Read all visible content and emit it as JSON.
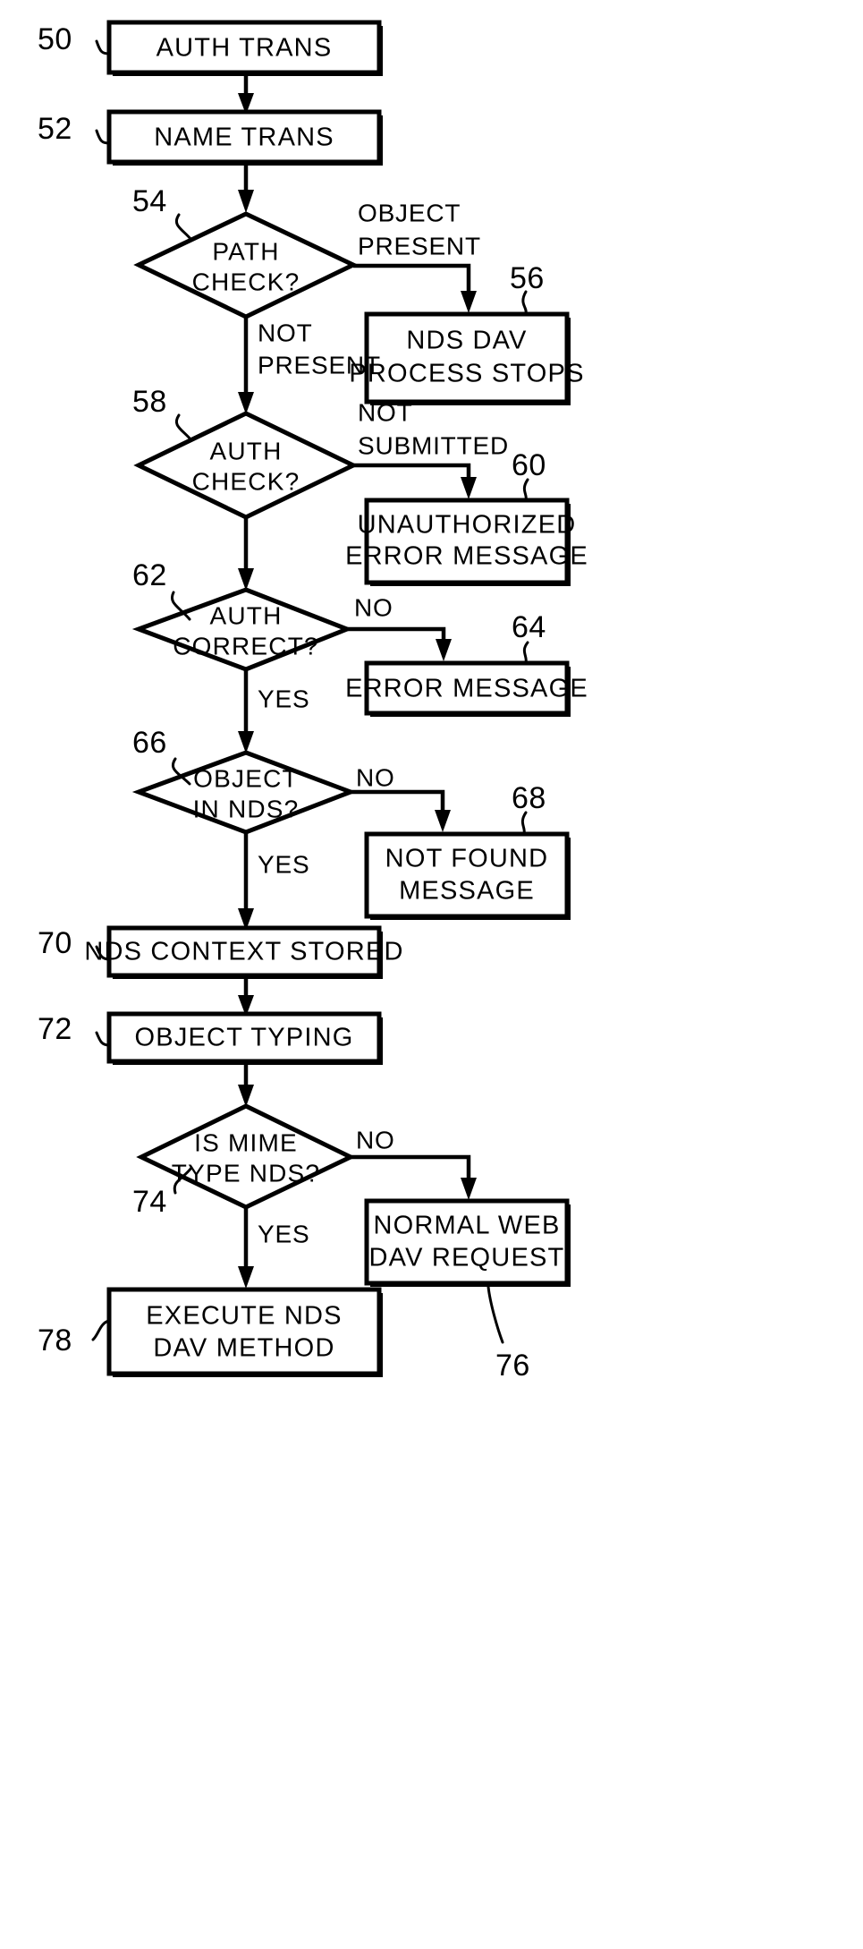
{
  "figure": {
    "title": "NDS DAV process flowchart",
    "line_color": "#000000",
    "fill_color": "#ffffff"
  },
  "nodes": [
    {
      "id": "n50",
      "ref": "50",
      "type": "process",
      "lines": [
        "AUTH TRANS"
      ]
    },
    {
      "id": "n52",
      "ref": "52",
      "type": "process",
      "lines": [
        "NAME TRANS"
      ]
    },
    {
      "id": "n54",
      "ref": "54",
      "type": "decision",
      "lines": [
        "PATH",
        "CHECK?"
      ]
    },
    {
      "id": "n56",
      "ref": "56",
      "type": "process",
      "lines": [
        "NDS DAV",
        "PROCESS STOPS"
      ]
    },
    {
      "id": "n58",
      "ref": "58",
      "type": "decision",
      "lines": [
        "AUTH",
        "CHECK?"
      ]
    },
    {
      "id": "n60",
      "ref": "60",
      "type": "process",
      "lines": [
        "UNAUTHORIZED",
        "ERROR MESSAGE"
      ]
    },
    {
      "id": "n62",
      "ref": "62",
      "type": "decision",
      "lines": [
        "AUTH",
        "CORRECT?"
      ]
    },
    {
      "id": "n64",
      "ref": "64",
      "type": "process",
      "lines": [
        "ERROR MESSAGE"
      ]
    },
    {
      "id": "n66",
      "ref": "66",
      "type": "decision",
      "lines": [
        "OBJECT",
        "IN NDS?"
      ]
    },
    {
      "id": "n68",
      "ref": "68",
      "type": "process",
      "lines": [
        "NOT FOUND",
        "MESSAGE"
      ]
    },
    {
      "id": "n70",
      "ref": "70",
      "type": "process",
      "lines": [
        "NDS CONTEXT STORED"
      ]
    },
    {
      "id": "n72",
      "ref": "72",
      "type": "process",
      "lines": [
        "OBJECT TYPING"
      ]
    },
    {
      "id": "n74",
      "ref": "74",
      "type": "decision",
      "lines": [
        "IS MIME",
        "TYPE NDS?"
      ]
    },
    {
      "id": "n76",
      "ref": "76",
      "type": "process",
      "lines": [
        "NORMAL WEB",
        "DAV REQUEST"
      ]
    },
    {
      "id": "n78",
      "ref": "78",
      "type": "process",
      "lines": [
        "EXECUTE NDS",
        "DAV METHOD"
      ]
    }
  ],
  "edge_labels": {
    "object_present": [
      "OBJECT",
      "PRESENT"
    ],
    "not_present": [
      "NOT",
      "PRESENT"
    ],
    "not_submitted": [
      "NOT",
      "SUBMITTED"
    ],
    "no_62": "NO",
    "yes_62": "YES",
    "no_66": "NO",
    "yes_66": "YES",
    "no_74": "NO",
    "yes_74": "YES"
  },
  "ref_numbers": [
    "50",
    "52",
    "54",
    "56",
    "58",
    "60",
    "62",
    "64",
    "66",
    "68",
    "70",
    "72",
    "74",
    "76",
    "78"
  ]
}
